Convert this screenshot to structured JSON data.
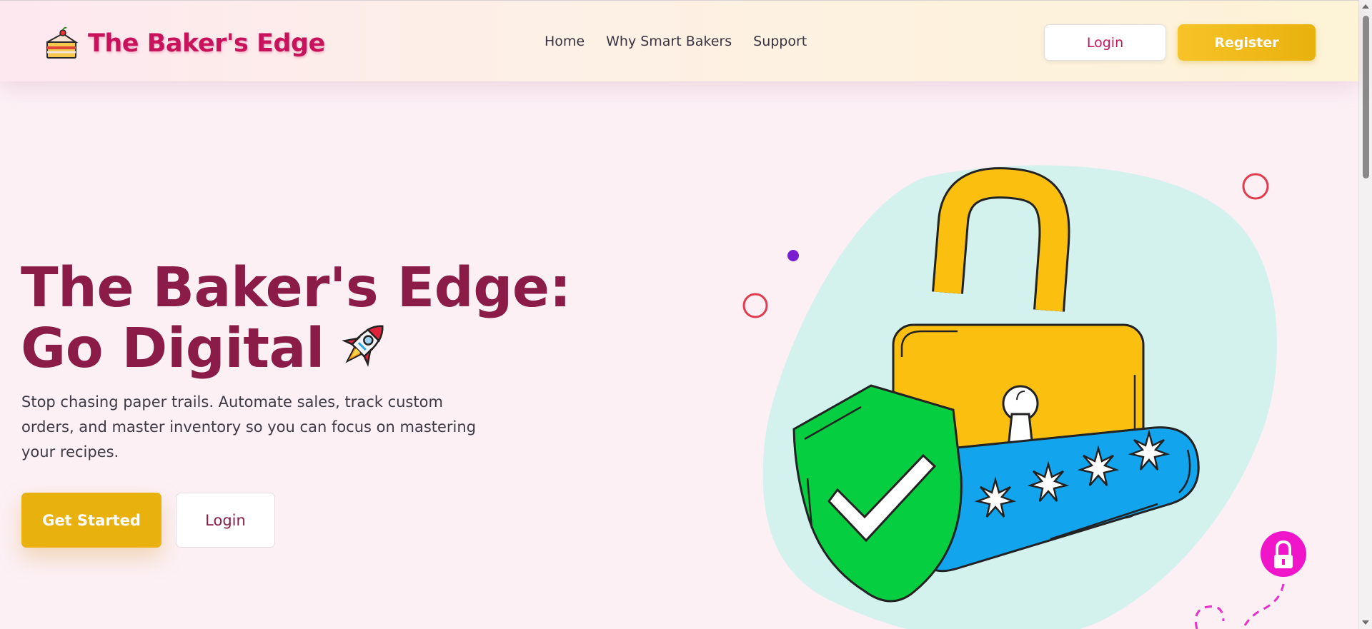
{
  "header": {
    "brand_name": "The Baker's Edge",
    "logo_icon": "cake-slice-icon",
    "nav": [
      {
        "label": "Home"
      },
      {
        "label": "Why Smart Bakers"
      },
      {
        "label": "Support"
      }
    ],
    "login_label": "Login",
    "register_label": "Register"
  },
  "hero": {
    "title": "The Baker's Edge: Go Digital",
    "title_icon": "rocket-icon",
    "subtitle": "Stop chasing paper trails. Automate sales, track custom orders, and master inventory so you can focus on mastering your recipes.",
    "primary_cta": "Get Started",
    "secondary_cta": "Login"
  },
  "illustration": {
    "icons": [
      "padlock-icon",
      "shield-check-icon",
      "password-field-icon",
      "lock-badge-icon"
    ]
  },
  "colors": {
    "brand": "#c8135c",
    "heading": "#8b1b47",
    "accent": "#e8b10d",
    "page_bg": "#fcf0f5"
  }
}
